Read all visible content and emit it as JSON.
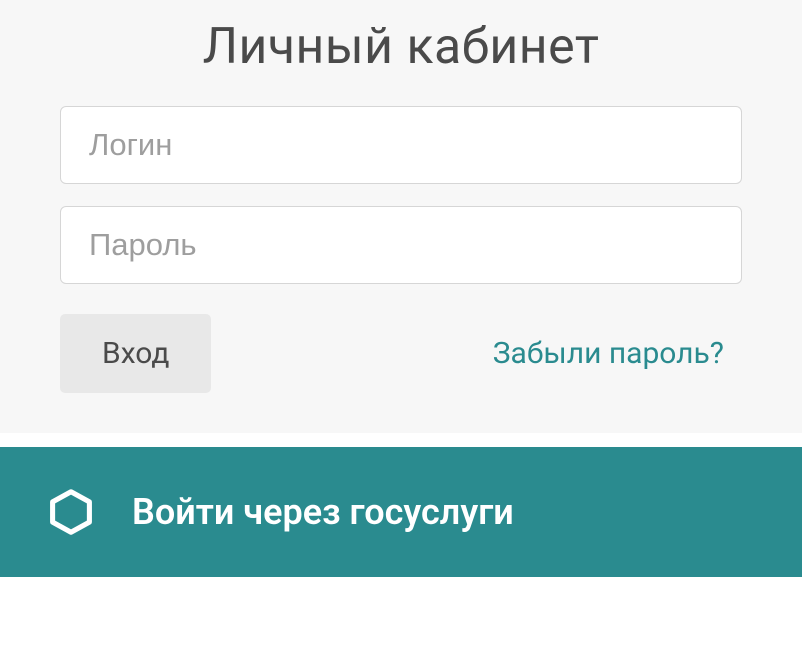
{
  "login": {
    "title": "Личный кабинет",
    "username_placeholder": "Логин",
    "password_placeholder": "Пароль",
    "submit_label": "Вход",
    "forgot_label": "Забыли пароль?"
  },
  "gosuslugi": {
    "label": "Войти через госуслуги"
  }
}
